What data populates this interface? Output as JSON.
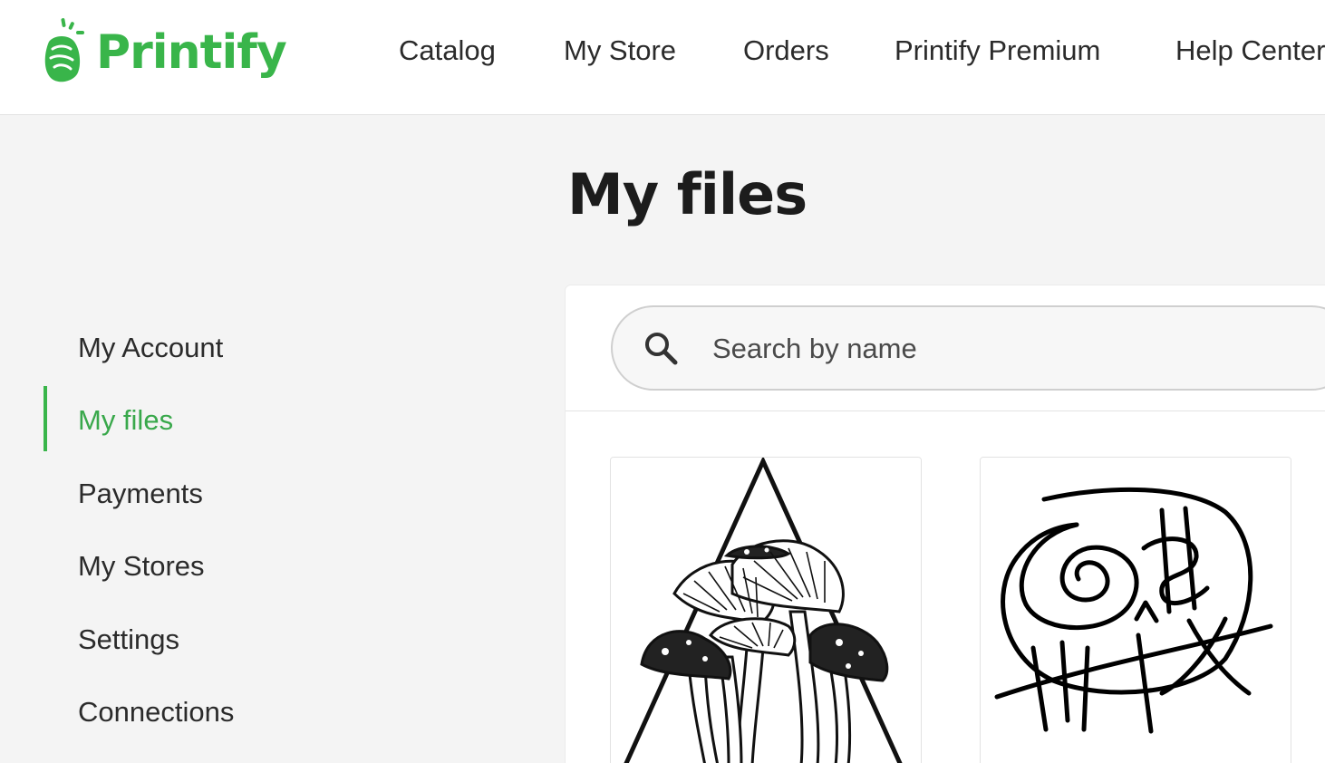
{
  "brand": {
    "name": "Printify",
    "color": "#39b54a"
  },
  "nav": {
    "items": [
      {
        "label": "Catalog"
      },
      {
        "label": "My Store"
      },
      {
        "label": "Orders"
      },
      {
        "label": "Printify Premium"
      },
      {
        "label": "Help Center"
      }
    ]
  },
  "page": {
    "title": "My files"
  },
  "sidebar": {
    "active_index": 1,
    "items": [
      {
        "label": "My Account"
      },
      {
        "label": "My files"
      },
      {
        "label": "Payments"
      },
      {
        "label": "My Stores"
      },
      {
        "label": "Settings"
      },
      {
        "label": "Connections"
      }
    ]
  },
  "search": {
    "placeholder": "Search by name",
    "value": "",
    "icon": "search-icon"
  },
  "files": [
    {
      "thumbnail": "mushrooms-triangle-illustration"
    },
    {
      "thumbnail": "spiral-scribble-drawing"
    }
  ]
}
